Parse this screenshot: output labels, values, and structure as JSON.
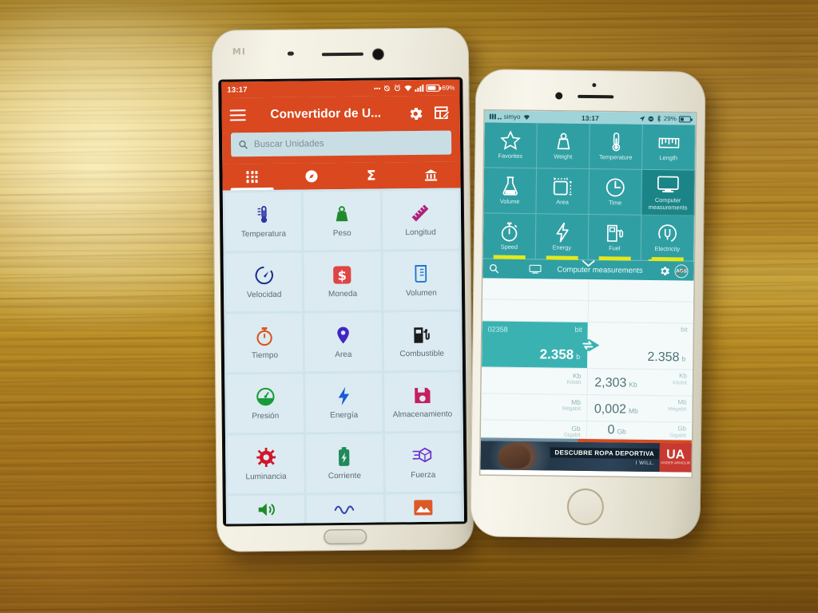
{
  "scene": {
    "description": "Two smartphones on a wooden table showing unit converter apps",
    "surface": "wood-table"
  },
  "android": {
    "brand_logo": "MI",
    "statusbar": {
      "clock": "13:17",
      "battery_percent": "69%",
      "icons": [
        "more-dots-icon",
        "alarm-off-icon",
        "alarm-clock-icon",
        "wifi-icon",
        "signal-icon",
        "battery-icon"
      ]
    },
    "appbar": {
      "menu_icon": "hamburger-icon",
      "title": "Convertidor de U...",
      "settings_icon": "gear-icon",
      "edit_icon": "edit-table-icon"
    },
    "search": {
      "placeholder": "Buscar Unidades",
      "value": "",
      "icon": "search-icon"
    },
    "tabs": [
      {
        "name": "grid",
        "icon": "grid-icon",
        "active": true
      },
      {
        "name": "compass",
        "icon": "compass-icon",
        "active": false
      },
      {
        "name": "sigma",
        "icon": "sigma-icon",
        "active": false
      },
      {
        "name": "bank",
        "icon": "bank-icon",
        "active": false
      }
    ],
    "categories": [
      {
        "label": "Temperatura",
        "icon": "thermometer-icon",
        "color": "#2f36a8"
      },
      {
        "label": "Peso",
        "icon": "weight-icon",
        "color": "#1f8a29"
      },
      {
        "label": "Longitud",
        "icon": "ruler-icon",
        "color": "#b0227c"
      },
      {
        "label": "Velocidad",
        "icon": "speedometer-icon",
        "color": "#1c2f8e"
      },
      {
        "label": "Moneda",
        "icon": "dollar-icon",
        "color": "#e04545"
      },
      {
        "label": "Volumen",
        "icon": "beaker-icon",
        "color": "#1a73d0"
      },
      {
        "label": "Tiempo",
        "icon": "stopwatch-icon",
        "color": "#d9561f"
      },
      {
        "label": "Area",
        "icon": "map-pin-icon",
        "color": "#4226c4"
      },
      {
        "label": "Combustible",
        "icon": "fuel-pump-icon",
        "color": "#1b1b1b"
      },
      {
        "label": "Presión",
        "icon": "gauge-icon",
        "color": "#189b3a"
      },
      {
        "label": "Energía",
        "icon": "bolt-icon",
        "color": "#1a5ad6"
      },
      {
        "label": "Almacenamiento",
        "icon": "floppy-disk-icon",
        "color": "#c41f5e"
      },
      {
        "label": "Luminancia",
        "icon": "brightness-icon",
        "color": "#d2142b"
      },
      {
        "label": "Corriente",
        "icon": "battery-icon",
        "color": "#1f8a5a"
      },
      {
        "label": "Fuerza",
        "icon": "cube-motion-icon",
        "color": "#6a31c9"
      }
    ],
    "partial_row": [
      {
        "label": "",
        "icon": "speaker-icon",
        "color": "#1f8a29"
      },
      {
        "label": "",
        "icon": "wave-icon",
        "color": "#3344b0"
      },
      {
        "label": "",
        "icon": "image-icon",
        "color": "#dd5a28"
      }
    ],
    "colors": {
      "accent": "#d9481f",
      "grid_bg": "#cfe4ec",
      "tile": "#dcebf1"
    }
  },
  "iphone": {
    "statusbar": {
      "carrier": "simyo",
      "clock": "13:17",
      "battery_percent": "29%",
      "icons": [
        "signal-icon",
        "wifi-icon",
        "location-icon",
        "do-not-disturb-icon",
        "bluetooth-icon",
        "battery-icon"
      ]
    },
    "categories": [
      {
        "label": "Favorites",
        "icon": "star-icon",
        "selected": false
      },
      {
        "label": "Weight",
        "icon": "weight-icon",
        "selected": false
      },
      {
        "label": "Temperature",
        "icon": "thermometer-icon",
        "selected": false
      },
      {
        "label": "Length",
        "icon": "ruler-icon",
        "selected": false
      },
      {
        "label": "Volume",
        "icon": "flask-icon",
        "selected": false
      },
      {
        "label": "Area",
        "icon": "area-square-icon",
        "selected": false
      },
      {
        "label": "Time",
        "icon": "clock-icon",
        "selected": false
      },
      {
        "label": "Computer measurements",
        "icon": "monitor-icon",
        "selected": true
      },
      {
        "label": "Speed",
        "icon": "stopwatch-icon",
        "selected": false
      },
      {
        "label": "Energy",
        "icon": "bolt-icon",
        "selected": false
      },
      {
        "label": "Fuel",
        "icon": "fuel-pump-icon",
        "selected": false
      },
      {
        "label": "Electricity",
        "icon": "plug-icon",
        "selected": false
      }
    ],
    "toolbar": {
      "search_icon": "search-icon",
      "chevron_icon": "chevron-down-icon",
      "category_icon": "monitor-icon",
      "title": "Computer measurements",
      "settings_icon": "gear-icon",
      "ads_label": "ADS",
      "ads_icon": "no-ads-icon"
    },
    "conversion": {
      "input_raw": "02358",
      "rows": [
        {
          "unit_short": "bit",
          "unit_long": "",
          "left_value": "2.358",
          "left_unit": "b",
          "right_value": "2.358",
          "right_unit": "b",
          "active": true
        },
        {
          "unit_short": "Kb",
          "unit_long": "Kilobit",
          "left_value": "",
          "left_unit": "",
          "right_value": "2,303",
          "right_unit": "Kb",
          "active": false
        },
        {
          "unit_short": "Mb",
          "unit_long": "Megabit",
          "left_value": "",
          "left_unit": "",
          "right_value": "0,002",
          "right_unit": "Mb",
          "active": false
        },
        {
          "unit_short": "Gb",
          "unit_long": "Gigabit",
          "left_value": "",
          "left_unit": "",
          "right_value": "0",
          "right_unit": "Gb",
          "active": false
        }
      ],
      "swap_icon": "swap-arrows-icon"
    },
    "ad": {
      "headline": "DESCUBRE ROPA DEPORTIVA",
      "tagline": "I WILL.",
      "brand_mark": "UA",
      "brand_name": "UNDER ARMOUR"
    },
    "colors": {
      "accent": "#2f9fa3",
      "selected": "#1b8487",
      "highlight": "#3bb2b2",
      "underline": "#e4e81c"
    }
  }
}
